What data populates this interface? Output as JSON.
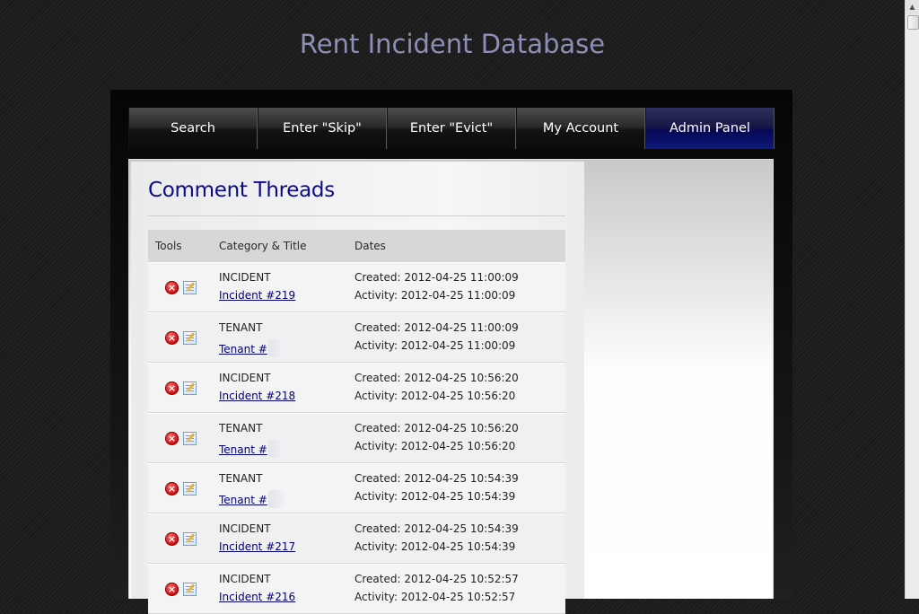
{
  "site": {
    "title": "Rent Incident Database"
  },
  "nav": {
    "items": [
      {
        "label": "Search"
      },
      {
        "label": "Enter \"Skip\""
      },
      {
        "label": "Enter \"Evict\""
      },
      {
        "label": "My Account"
      },
      {
        "label": "Admin Panel"
      }
    ],
    "active": "Admin Panel",
    "active_color": "#0d1a7a"
  },
  "page": {
    "title": "Comment Threads"
  },
  "table": {
    "headers": {
      "tools": "Tools",
      "category_title": "Category & Title",
      "dates": "Dates"
    },
    "rows": [
      {
        "category": "INCIDENT",
        "title": "Incident #219",
        "created": "Created: 2012-04-25 11:00:09",
        "activity": "Activity: 2012-04-25 11:00:09"
      },
      {
        "category": "TENANT",
        "title": "Tenant #",
        "created": "Created: 2012-04-25 11:00:09",
        "activity": "Activity: 2012-04-25 11:00:09"
      },
      {
        "category": "INCIDENT",
        "title": "Incident #218",
        "created": "Created: 2012-04-25 10:56:20",
        "activity": "Activity: 2012-04-25 10:56:20"
      },
      {
        "category": "TENANT",
        "title": "Tenant #",
        "created": "Created: 2012-04-25 10:56:20",
        "activity": "Activity: 2012-04-25 10:56:20"
      },
      {
        "category": "TENANT",
        "title": "Tenant #",
        "created": "Created: 2012-04-25 10:54:39",
        "activity": "Activity: 2012-04-25 10:54:39"
      },
      {
        "category": "INCIDENT",
        "title": "Incident #217",
        "created": "Created: 2012-04-25 10:54:39",
        "activity": "Activity: 2012-04-25 10:54:39"
      },
      {
        "category": "INCIDENT",
        "title": "Incident #216",
        "created": "Created: 2012-04-25 10:52:57",
        "activity": "Activity: 2012-04-25 10:52:57"
      }
    ]
  },
  "icons": {
    "delete": "delete-icon",
    "edit": "edit-icon"
  },
  "colors": {
    "title": "#8e8fb6",
    "heading": "#0b0b8a",
    "link": "#00007a",
    "delete": "#d41414"
  }
}
